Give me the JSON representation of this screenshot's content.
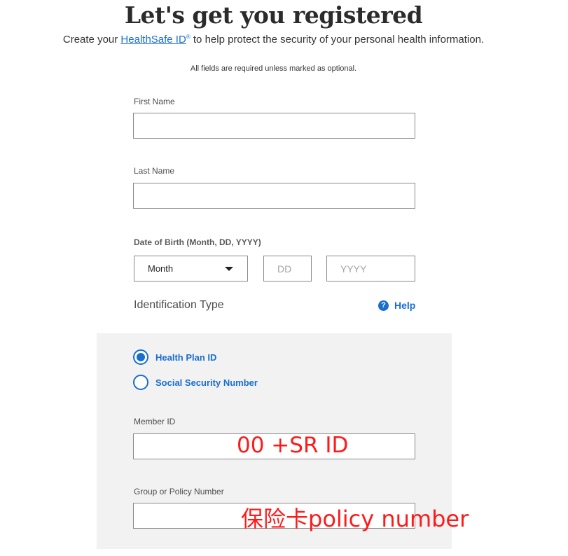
{
  "header": {
    "title": "Let's get you registered",
    "subtitle_before": "Create your ",
    "subtitle_link": "HealthSafe ID",
    "subtitle_sup": "®",
    "subtitle_after": " to help protect the security of your personal health information.",
    "required_note": "All fields are required unless marked as optional."
  },
  "form": {
    "first_name": {
      "label": "First Name",
      "value": ""
    },
    "last_name": {
      "label": "Last Name",
      "value": ""
    },
    "dob": {
      "label": "Date of Birth (Month, DD, YYYY)",
      "month_selected": "Month",
      "day_placeholder": "DD",
      "year_placeholder": "YYYY"
    },
    "identification": {
      "heading": "Identification Type",
      "help_label": "Help",
      "help_icon": "question-circle-icon",
      "options": [
        {
          "label": "Health Plan ID",
          "checked": true
        },
        {
          "label": "Social Security Number",
          "checked": false
        }
      ],
      "member_id": {
        "label": "Member ID",
        "value": ""
      },
      "group_number": {
        "label": "Group or Policy Number",
        "value": ""
      }
    }
  },
  "annotations": {
    "member_id_note": "00 +SR ID",
    "policy_note": "保险卡policy number"
  },
  "colors": {
    "link": "#196ecf",
    "annotation": "#ff1a1a",
    "panel_bg": "#f2f2f2"
  }
}
